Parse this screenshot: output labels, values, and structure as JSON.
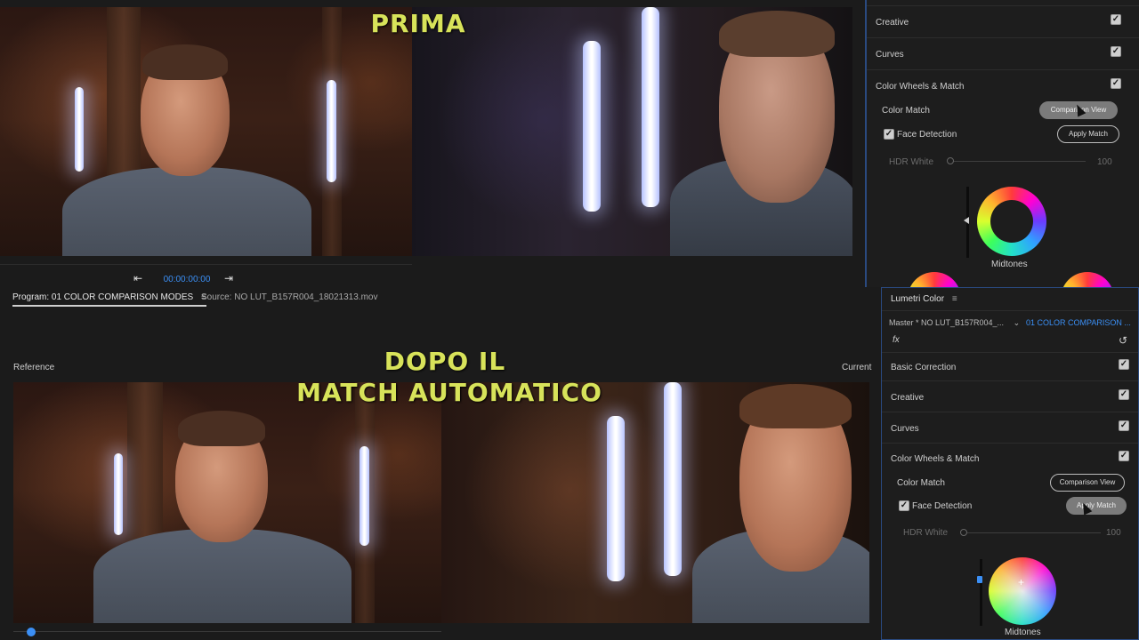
{
  "captions": {
    "before": "PRIMA",
    "after_line1": "DOPO IL",
    "after_line2": "MATCH AUTOMATICO"
  },
  "top_monitor": {
    "timecode": "00:00:00:00",
    "go_to_in_icon": "step-back-icon",
    "go_to_out_icon": "step-forward-icon"
  },
  "tabs": {
    "program": "Program: 01 COLOR COMPARISON MODES",
    "source": "Source: NO LUT_B157R004_18021313.mov"
  },
  "bottom_monitor": {
    "reference_label": "Reference",
    "current_label": "Current"
  },
  "top_panel": {
    "creative": "Creative",
    "curves": "Curves",
    "color_wheels": "Color Wheels & Match",
    "color_match": "Color Match",
    "comparison_view": "Comparison View",
    "face_detection": "Face Detection",
    "apply_match": "Apply Match",
    "hdr_white": "HDR White",
    "hdr_value": "100",
    "midtones": "Midtones"
  },
  "lumetri": {
    "title": "Lumetri Color",
    "master_clip": "Master * NO LUT_B157R004_...",
    "sequence_clip": "01 COLOR COMPARISON ...",
    "fx": "fx",
    "basic_correction": "Basic Correction",
    "creative": "Creative",
    "curves": "Curves",
    "color_wheels": "Color Wheels & Match",
    "color_match": "Color Match",
    "comparison_view": "Comparison View",
    "face_detection": "Face Detection",
    "apply_match": "Apply Match",
    "hdr_white": "HDR White",
    "hdr_value": "100",
    "midtones": "Midtones"
  },
  "colors": {
    "caption": "#d8e35a",
    "accent_blue": "#3b8ff5",
    "panel_bg": "#1d1d1d"
  }
}
